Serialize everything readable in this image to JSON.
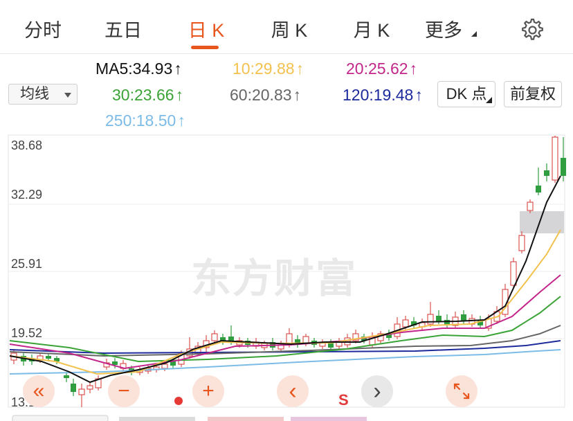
{
  "tabs": [
    {
      "label": "分时",
      "active": false
    },
    {
      "label": "五日",
      "active": false
    },
    {
      "label": "日 K",
      "active": true
    },
    {
      "label": "周 K",
      "active": false
    },
    {
      "label": "月 K",
      "active": false
    },
    {
      "label": "更多",
      "active": false
    }
  ],
  "icons": {
    "more_caret": "small-triangle-icon",
    "settings": "gear-icon",
    "up_arrow": "↑",
    "zoom_out": "«",
    "minus": "−",
    "plus": "+",
    "prev": "‹",
    "next": "›",
    "expand": "expand-arrows-icon"
  },
  "ma_row": {
    "ma5": "MA5:34.93",
    "ma10": "10:29.88",
    "ma20": "20:25.62",
    "ma30": "30:23.66",
    "ma60": "60:20.83",
    "ma120": "120:19.48",
    "ma250": "250:18.50"
  },
  "colors": {
    "accent": "#e8561e",
    "ma5": "#111111",
    "ma10": "#f2c14e",
    "ma20": "#c2268a",
    "ma30": "#3aa335",
    "ma60": "#666666",
    "ma120": "#1c2a9c",
    "ma250": "#7bbbe6",
    "up_candle": "#d9534f",
    "down_candle": "#2e9e3e"
  },
  "controls": {
    "indicator_select": "均线",
    "dk_label": "DK 点",
    "fq_label": "前复权"
  },
  "chart": {
    "y_labels": [
      "38.68",
      "32.29",
      "25.91",
      "19.52",
      "13.13"
    ],
    "watermark": "东方财富",
    "s_label": "S"
  }
}
